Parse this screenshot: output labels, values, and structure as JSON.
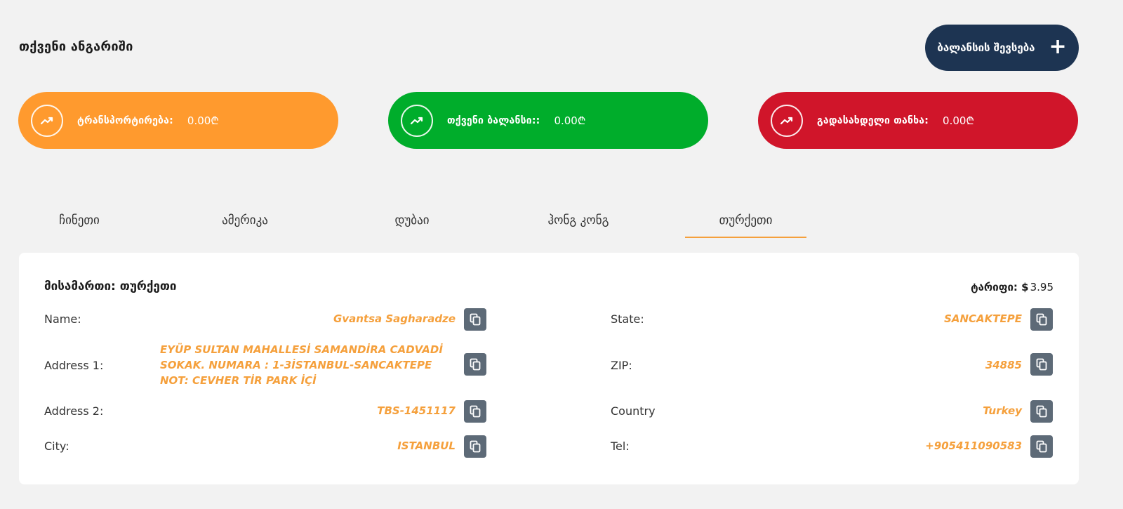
{
  "header": {
    "title": "თქვენი ანგარიში",
    "add_balance_label": "ბალანსის შევსება"
  },
  "stats": [
    {
      "label": "ტრანსპორტირება:",
      "value": "0.00₾",
      "color": "#ff9a2e"
    },
    {
      "label": "თქვენი ბალანსი::",
      "value": "0.00₾",
      "color": "#00ad2b"
    },
    {
      "label": "გადასახდელი თანხა:",
      "value": "0.00₾",
      "color": "#d0152a"
    }
  ],
  "tabs": [
    {
      "label": "ჩინეთი",
      "active": false
    },
    {
      "label": "ამერიკა",
      "active": false
    },
    {
      "label": "დუბაი",
      "active": false
    },
    {
      "label": "ჰონგ კონგ",
      "active": false
    },
    {
      "label": "თურქეთი",
      "active": true
    }
  ],
  "address_card": {
    "title": "მისამართი: თურქეთი",
    "tariff_label": "ტარიფი:",
    "tariff_currency": "$",
    "tariff_value": "3.95",
    "left_fields": [
      {
        "label": "Name:",
        "value": "Gvantsa Sagharadze"
      },
      {
        "label": "Address 1:",
        "value_lines": [
          "EYÜP SULTAN MAHALLESİ SAMANDİRA CADVADİ",
          "SOKAK. NUMARA : 1-3İSTANBUL-SANCAKTEPE",
          "NOT: CEVHER TİR PARK İÇİ"
        ]
      },
      {
        "label": "Address 2:",
        "value": "TBS-1451117"
      },
      {
        "label": "City:",
        "value": "ISTANBUL"
      }
    ],
    "right_fields": [
      {
        "label": "State:",
        "value": "SANCAKTEPE"
      },
      {
        "label": "ZIP:",
        "value": "34885"
      },
      {
        "label": "Country",
        "value": "Turkey"
      },
      {
        "label": "Tel:",
        "value": "+905411090583"
      }
    ]
  },
  "colors": {
    "accent": "#f5a03c",
    "navy": "#1d3452",
    "copy_button": "#5d6a77"
  },
  "icons": {
    "stat_icon": "trending-up-icon",
    "copy_icon": "copy-icon",
    "add_icon": "plus-icon"
  }
}
